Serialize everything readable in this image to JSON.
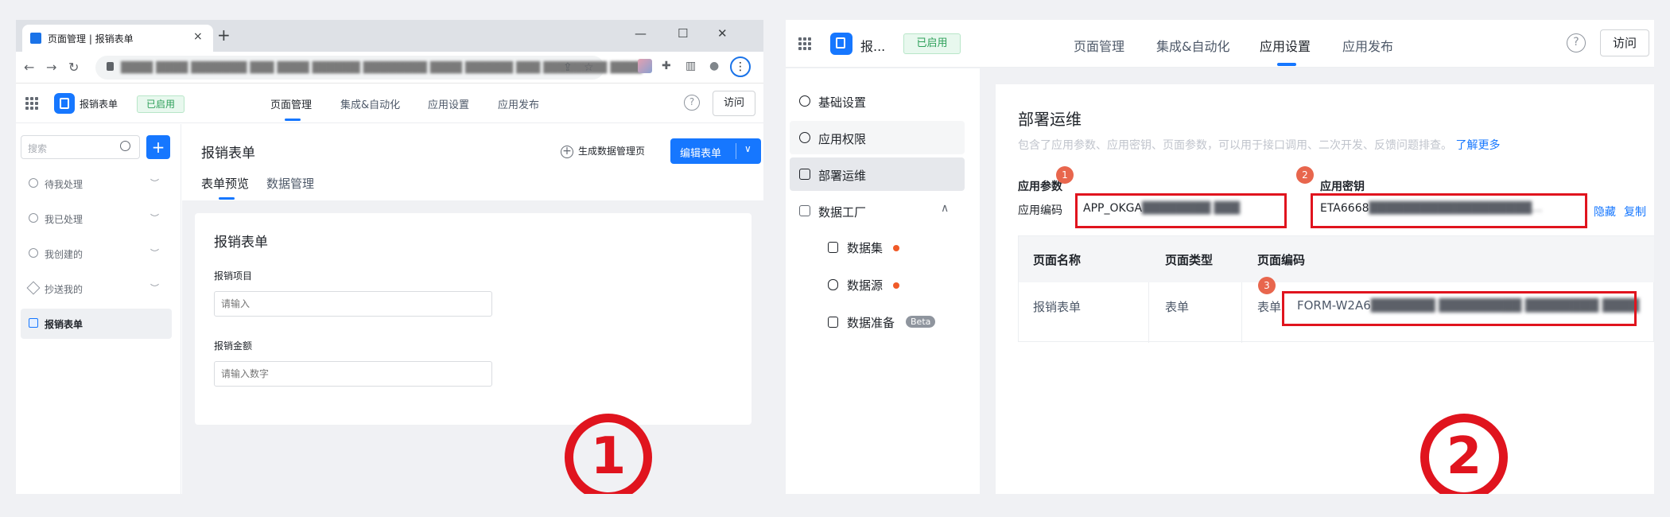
{
  "panel1": {
    "browser": {
      "tab_title": "页面管理 | 报销表单",
      "tab_close": "×",
      "new_tab": "+",
      "win_min": "—",
      "win_max": "☐",
      "win_close": "✕",
      "back": "←",
      "forward": "→",
      "reload": "↻",
      "url_blurred": "████ ████ ███████ ███ ████ ██████ ████████ ████ ██████ ███ ████████ ████",
      "share": "⇪",
      "star": "☆",
      "extension": "✚",
      "side_panel": "▥",
      "profile": "●",
      "menu": "⋮"
    },
    "app": {
      "name": "报销表单",
      "status": "已启用",
      "nav": [
        "页面管理",
        "集成&自动化",
        "应用设置",
        "应用发布"
      ],
      "help": "?",
      "visit": "访问"
    },
    "sidebar": {
      "search_placeholder": "搜索",
      "add": "+",
      "items": [
        {
          "label": "待我处理",
          "eye": "︶"
        },
        {
          "label": "我已处理",
          "eye": "︶"
        },
        {
          "label": "我创建的",
          "eye": "︶"
        },
        {
          "label": "抄送我的",
          "eye": "︶"
        },
        {
          "label": "报销表单"
        }
      ]
    },
    "content": {
      "title": "报销表单",
      "gen_link": "生成数据管理页",
      "gen_icon": "+",
      "edit_button": "编辑表单",
      "edit_caret": "∨",
      "tabs": [
        "表单预览",
        "数据管理"
      ],
      "form": {
        "title": "报销表单",
        "fields": [
          {
            "label": "报销项目",
            "placeholder": "请输入"
          },
          {
            "label": "报销金额",
            "placeholder": "请输入数字"
          }
        ]
      }
    },
    "marker": "1"
  },
  "panel2": {
    "app": {
      "name": "报...",
      "status": "已启用",
      "nav": [
        "页面管理",
        "集成&自动化",
        "应用设置",
        "应用发布"
      ],
      "help": "?",
      "visit": "访问"
    },
    "sidebar": {
      "items": [
        "基础设置",
        "应用权限",
        "部署运维",
        "数据工厂"
      ],
      "chevron": "∧",
      "sub_items": [
        "数据集",
        "数据源",
        "数据准备"
      ],
      "beta": "Beta"
    },
    "main": {
      "title": "部署运维",
      "desc": "包含了应用参数、应用密钥、页面参数，可以用于接口调用、二次开发、反馈问题排查。",
      "learn_more": "了解更多",
      "app_params_label": "应用参数",
      "app_code_label": "应用编码",
      "app_code_value": "APP_OKGA",
      "app_code_blurred": "████████ ███",
      "app_secret_label": "应用密钥",
      "app_secret_value": "ETA6668",
      "app_secret_blurred": "███████████████████...",
      "hide": "隐藏",
      "copy": "复制",
      "table": {
        "headers": [
          "页面名称",
          "页面类型",
          "页面编码"
        ],
        "row": {
          "name": "报销表单",
          "type": "表单",
          "code_prefix": "表单:",
          "code_value": "FORM-W2A6",
          "code_blurred": "███████ █████████ ████████ ████"
        }
      },
      "badges": [
        "1",
        "2",
        "3"
      ]
    },
    "marker": "2"
  },
  "colors": {
    "accent": "#1677ff",
    "status_green": "#2ea05a",
    "highlight_red": "#e0141e",
    "badge_orange": "#e8664d"
  }
}
